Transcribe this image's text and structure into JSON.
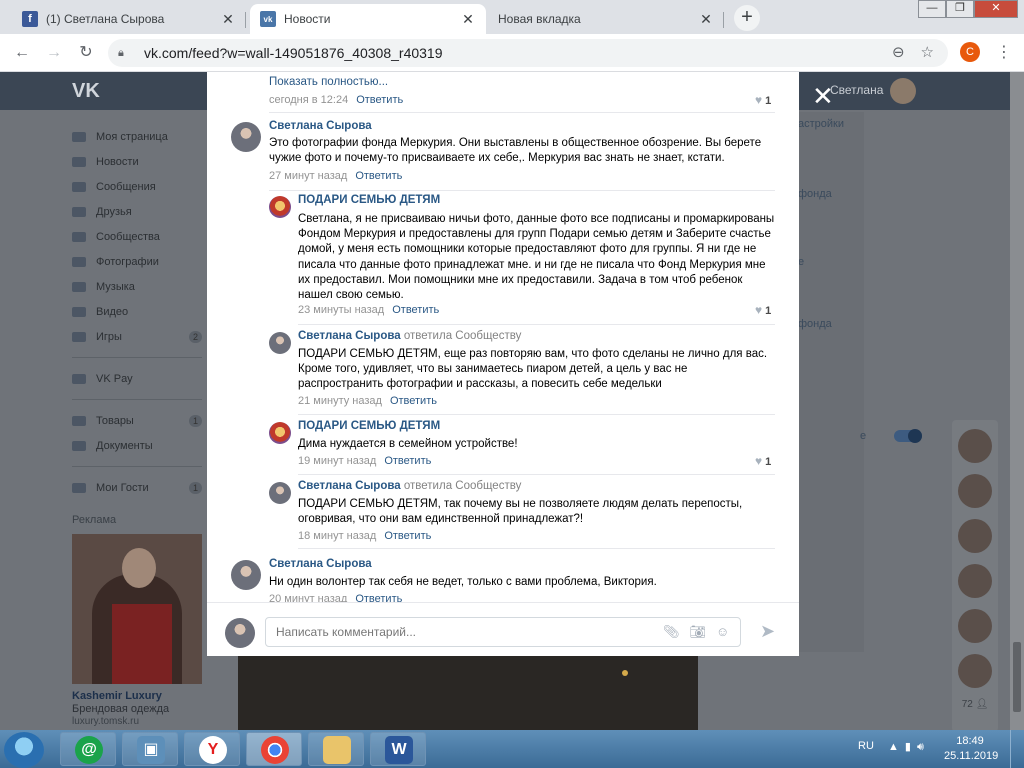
{
  "browser": {
    "tabs": [
      {
        "label": "(1) Светлана Сырова",
        "favicon": "f",
        "favicon_color": "#3b5998"
      },
      {
        "label": "Новости",
        "favicon": "vk",
        "favicon_color": "#4a76a8"
      },
      {
        "label": "Новая вкладка",
        "favicon": "",
        "favicon_color": ""
      }
    ],
    "url": "vk.com/feed?w=wall-149051876_40308_r40319",
    "profile_initial": "С"
  },
  "vk": {
    "user_name": "Светлана",
    "nav": [
      {
        "label": "Моя страница",
        "badge": ""
      },
      {
        "label": "Новости",
        "badge": ""
      },
      {
        "label": "Сообщения",
        "badge": ""
      },
      {
        "label": "Друзья",
        "badge": ""
      },
      {
        "label": "Сообщества",
        "badge": ""
      },
      {
        "label": "Фотографии",
        "badge": ""
      },
      {
        "label": "Музыка",
        "badge": ""
      },
      {
        "label": "Видео",
        "badge": ""
      },
      {
        "label": "Игры",
        "badge": "2"
      }
    ],
    "nav2": [
      {
        "label": "VK Pay",
        "badge": ""
      }
    ],
    "nav3": [
      {
        "label": "Товары",
        "badge": "1"
      },
      {
        "label": "Документы",
        "badge": ""
      }
    ],
    "nav4": [
      {
        "label": "Мои Гости",
        "badge": "1"
      }
    ],
    "ad_label": "Реклама",
    "ad_title": "Kashemir Luxury",
    "ad_subtitle": "Брендовая одежда",
    "ad_link": "luxury.tomsk.ru",
    "right_texts": [
      "астройки",
      "фонда",
      "е",
      "фонда",
      "е"
    ],
    "friends_count": "72"
  },
  "modal": {
    "top": {
      "show_more": "Показать полностью...",
      "time": "сегодня в 12:24",
      "reply": "Ответить",
      "likes": "1"
    },
    "comments": [
      {
        "author": "Светлана Сырова",
        "replied": "",
        "level": 0,
        "text": "Это фотографии фонда Меркурия. Они выставлены в общественное обозрение. Вы берете чужие фото и почему-то присваиваете их себе,. Меркурия вас знать не знает, кстати.",
        "time": "27 минут назад",
        "reply": "Ответить",
        "likes": ""
      },
      {
        "author": "ПОДАРИ СЕМЬЮ ДЕТЯМ",
        "replied": "",
        "level": 1,
        "text": "Светлана, я не присваиваю ничьи фото, данные фото все подписаны и промаркированы Фондом Меркурия и предоставлены для групп Подари семью детям и Заберите счастье домой, у меня есть помощники которые предоставляют фото для группы. Я ни где не писала что данные фото принадлежат мне. и ни где не писала что Фонд Меркурия мне их предоставил. Мои помощники мне их предоставили. Задача в том чтоб ребенок нашел свою семью.",
        "time": "23 минуты назад",
        "reply": "Ответить",
        "likes": "1"
      },
      {
        "author": "Светлана Сырова",
        "replied": "ответила Сообществу",
        "level": 1,
        "text": "ПОДАРИ СЕМЬЮ ДЕТЯМ, еще раз повторяю вам, что фото сделаны не лично для вас. Кроме того, удивляет, что вы занимаетесь пиаром детей, а цель у вас не распространить фотографии и рассказы, а повесить себе медельки",
        "time": "21 минуту назад",
        "reply": "Ответить",
        "likes": ""
      },
      {
        "author": "ПОДАРИ СЕМЬЮ ДЕТЯМ",
        "replied": "",
        "level": 1,
        "text": "Дима нуждается в семейном устройстве!",
        "time": "19 минут назад",
        "reply": "Ответить",
        "likes": "1"
      },
      {
        "author": "Светлана Сырова",
        "replied": "ответила Сообществу",
        "level": 1,
        "text": "ПОДАРИ СЕМЬЮ ДЕТЯМ, так почему вы не позволяете людям делать перепосты, оговривая, что они вам единственной принадлежат?!",
        "time": "18 минут назад",
        "reply": "Ответить",
        "likes": ""
      },
      {
        "author": "Светлана Сырова",
        "replied": "",
        "level": 0,
        "text": "Ни один волонтер так себя не ведет, только с вами проблема, Виктория.",
        "time": "20 минут назад",
        "reply": "Ответить",
        "likes": ""
      }
    ],
    "comment_placeholder": "Написать комментарий..."
  },
  "taskbar": {
    "lang": "RU",
    "time": "18:49",
    "date": "25.11.2019"
  },
  "colors": {
    "vk_link": "#2a5885",
    "vk_header": "#3b4654",
    "taskbar": "#3b6b96"
  }
}
